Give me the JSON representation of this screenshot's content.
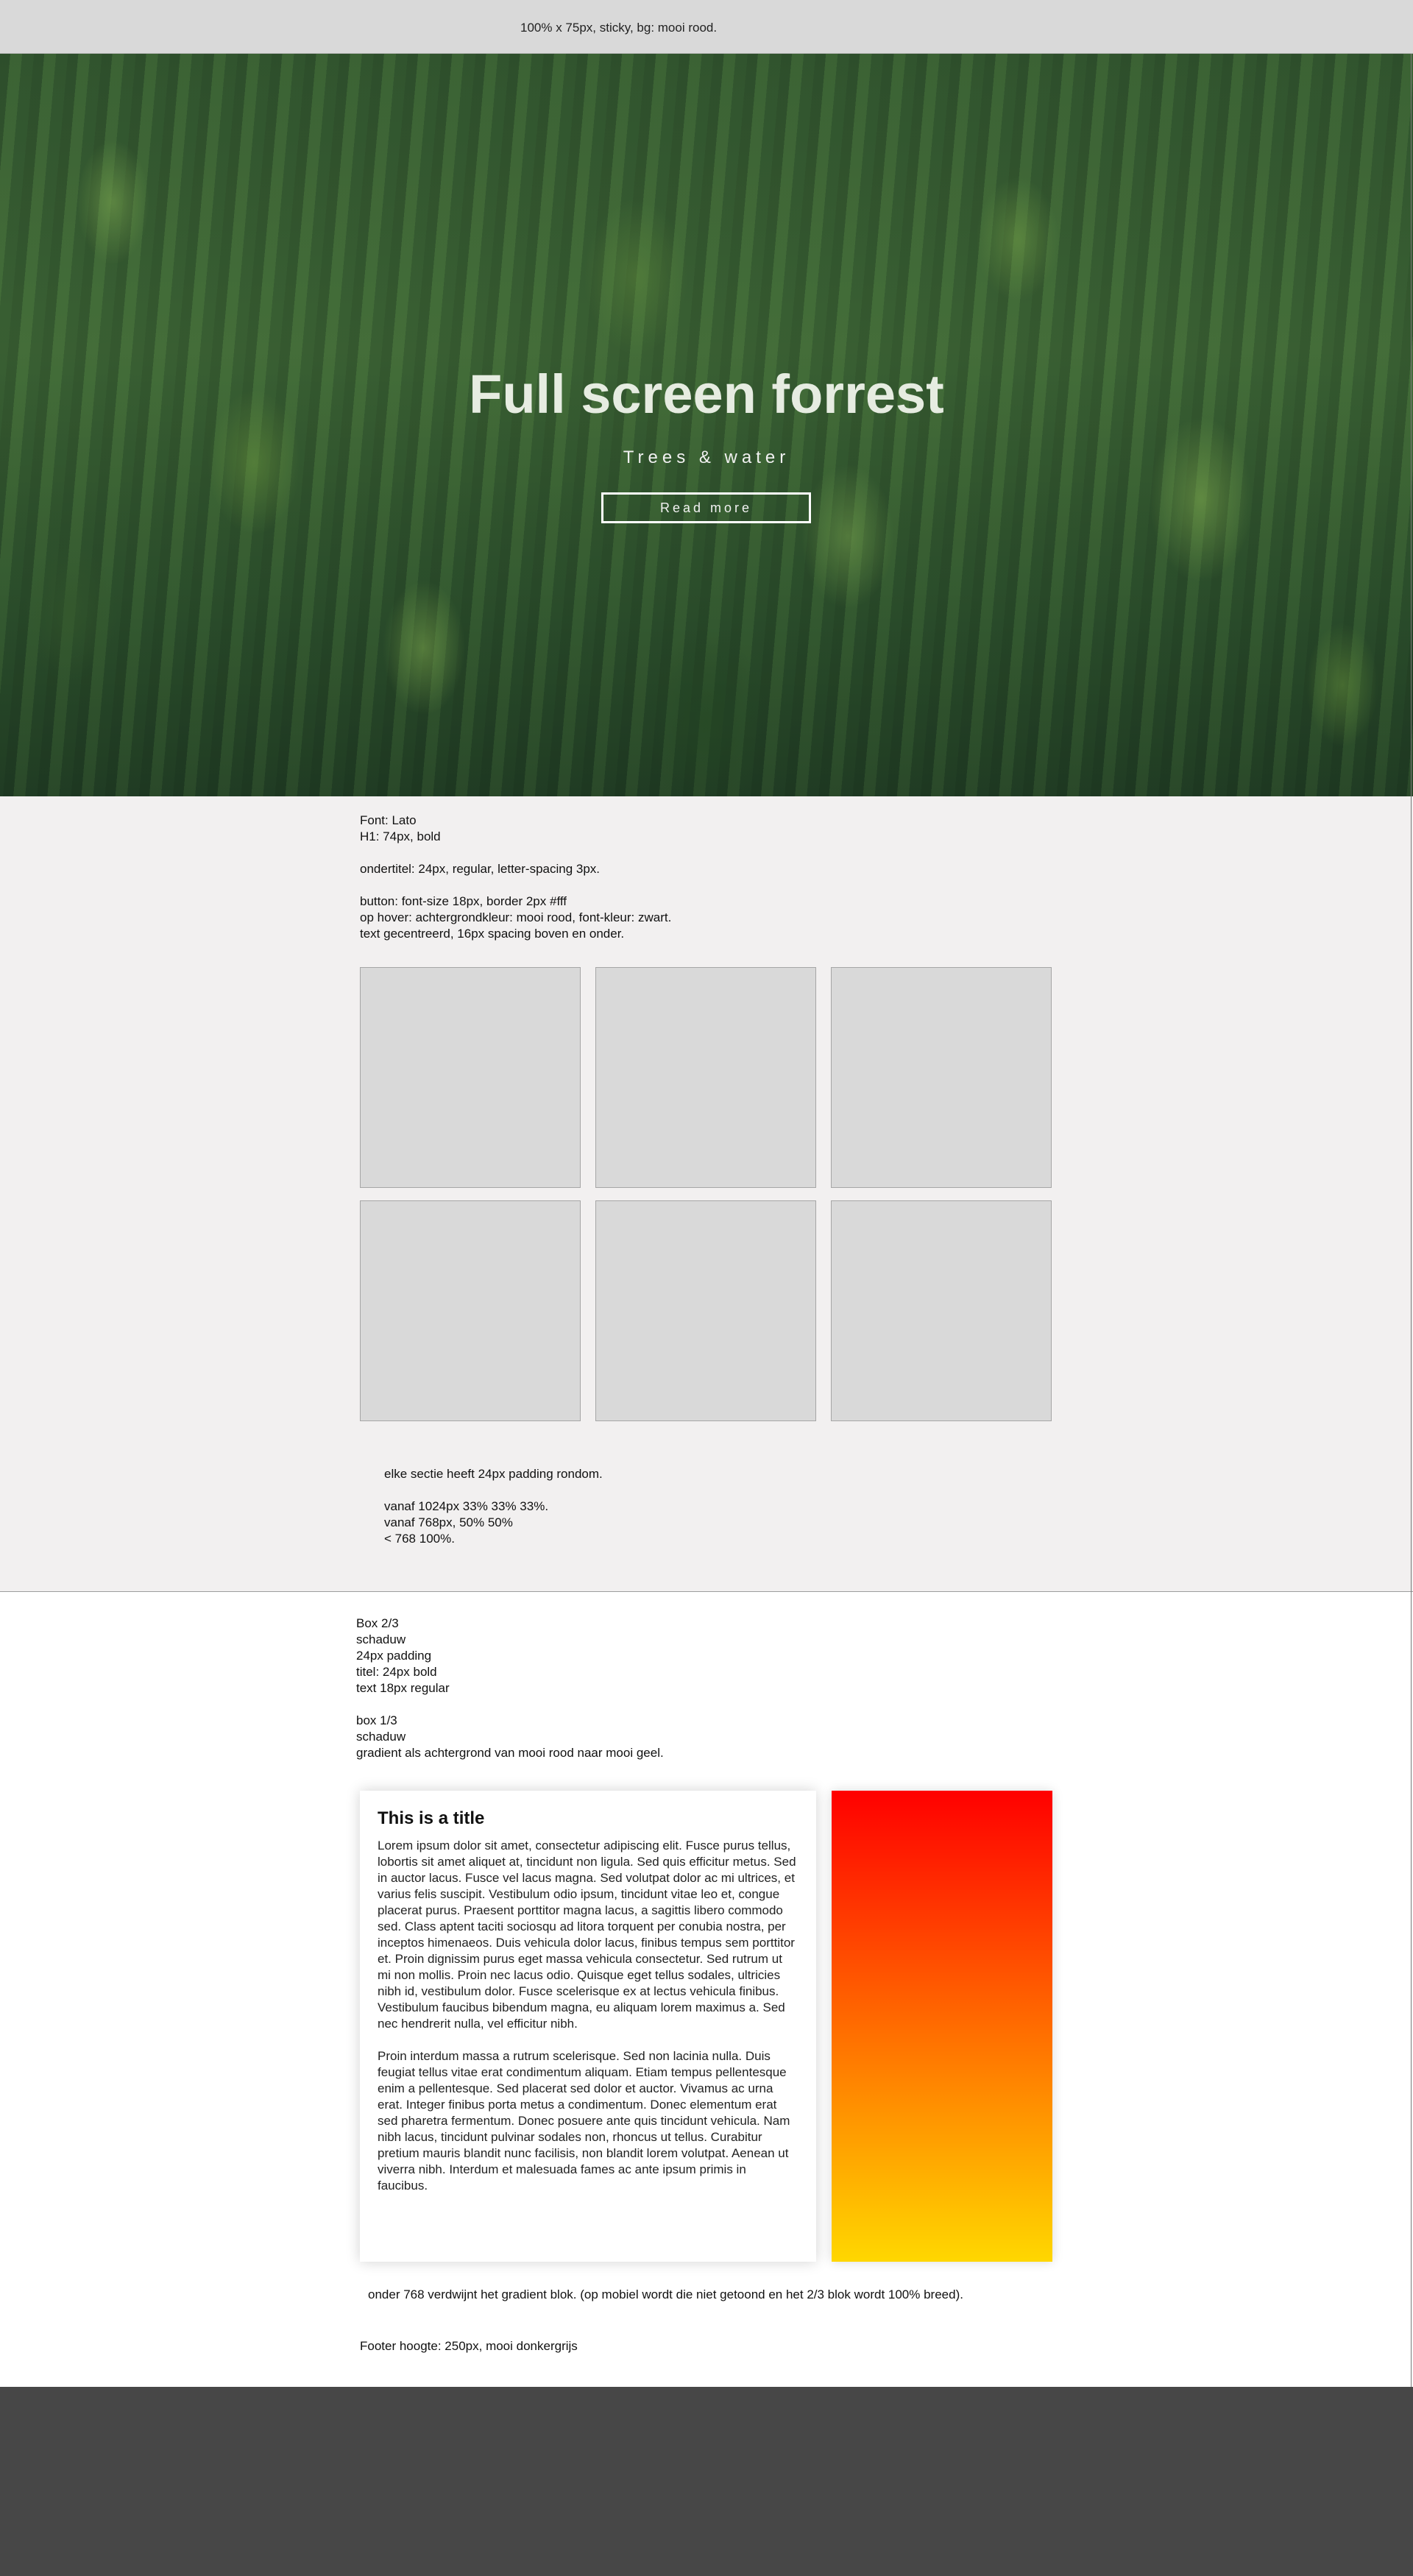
{
  "header": {
    "note": "100% x 75px, sticky, bg: mooi rood."
  },
  "hero": {
    "title": "Full screen forrest",
    "subtitle": "Trees & water",
    "button_label": "Read more"
  },
  "section1": {
    "notes": [
      "Font: Lato",
      "H1: 74px, bold",
      "",
      "ondertitel: 24px, regular, letter-spacing 3px.",
      "",
      "button: font-size 18px, border 2px #fff",
      "op hover: achtergrondkleur: mooi rood, font-kleur: zwart.",
      "text gecentreerd, 16px spacing boven en onder."
    ],
    "notes2": [
      "elke sectie heeft 24px padding rondom.",
      "",
      "vanaf 1024px 33% 33% 33%.",
      "vanaf 768px, 50% 50%",
      "< 768 100%."
    ]
  },
  "section2": {
    "notes": [
      "Box 2/3",
      "schaduw",
      "24px padding",
      "titel: 24px bold",
      "text 18px regular",
      "",
      "box 1/3",
      "schaduw",
      "gradient als achtergrond van mooi rood naar mooi geel."
    ],
    "card": {
      "title": "This is a title",
      "paragraph1": "Lorem ipsum dolor sit amet, consectetur adipiscing elit. Fusce purus tellus, lobortis sit amet aliquet at, tincidunt non ligula. Sed quis efficitur metus. Sed in auctor lacus. Fusce vel lacus magna. Sed volutpat dolor ac mi ultrices, et varius felis suscipit. Vestibulum odio ipsum, tincidunt vitae leo et, congue placerat purus. Praesent porttitor magna lacus, a sagittis libero commodo sed. Class aptent taciti sociosqu ad litora torquent per conubia nostra, per inceptos himenaeos. Duis vehicula dolor lacus, finibus tempus sem porttitor et. Proin dignissim purus eget massa vehicula consectetur. Sed rutrum ut mi non mollis. Proin nec lacus odio. Quisque eget tellus sodales, ultricies nibh id, vestibulum dolor. Fusce scelerisque ex at lectus vehicula finibus. Vestibulum faucibus bibendum magna, eu aliquam lorem maximus a. Sed nec hendrerit nulla, vel efficitur nibh.",
      "paragraph2": "Proin interdum massa a rutrum scelerisque. Sed non lacinia nulla. Duis feugiat tellus vitae erat condimentum aliquam. Etiam tempus pellentesque enim a pellentesque. Sed placerat sed dolor et auctor. Vivamus ac urna erat. Integer finibus porta metus a condimentum. Donec elementum erat sed pharetra fermentum. Donec posuere ante quis tincidunt vehicula. Nam nibh lacus, tincidunt pulvinar sodales non, rhoncus ut tellus. Curabitur pretium mauris blandit nunc facilisis, non blandit lorem volutpat. Aenean ut viverra nibh. Interdum et malesuada fames ac ante ipsum primis in faucibus."
    },
    "note_below": "onder 768 verdwijnt het gradient blok. (op mobiel wordt die niet getoond en het 2/3 blok wordt 100% breed).",
    "footer_note": "Footer hoogte: 250px, mooi donkergrijs"
  },
  "colors": {
    "header_bg": "#d9d9d9",
    "gradient_start": "#ff0000",
    "gradient_end": "#ffd700",
    "footer_bg": "#474747"
  }
}
